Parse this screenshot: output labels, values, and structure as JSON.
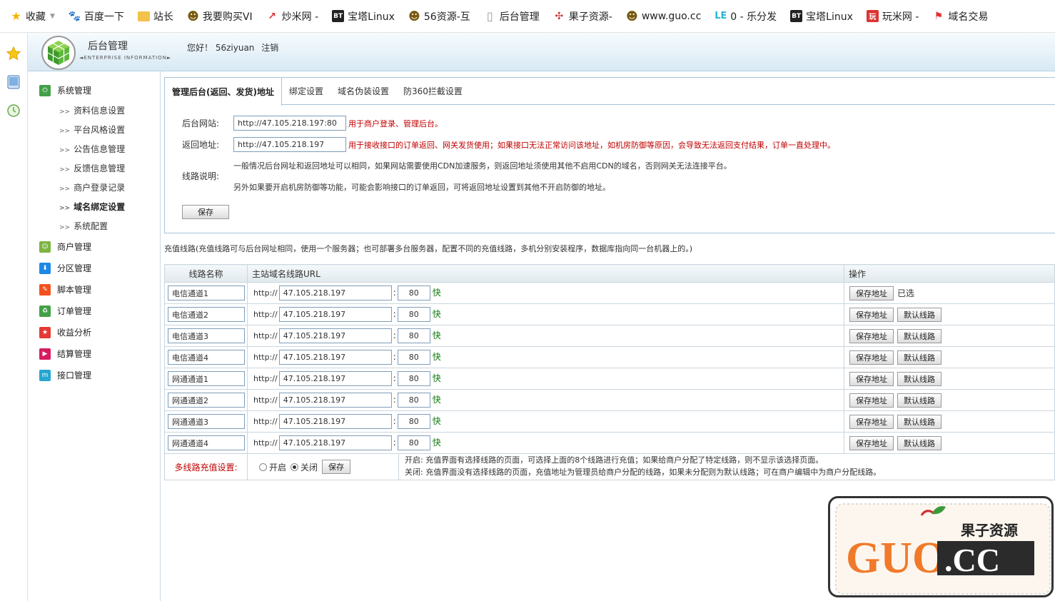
{
  "bookmarks": [
    {
      "label": "收藏",
      "icon": "star-icon"
    },
    {
      "label": "百度一下",
      "icon": "baidu-icon"
    },
    {
      "label": "站长",
      "icon": "folder-icon"
    },
    {
      "label": "我要购买VI",
      "icon": "face-icon"
    },
    {
      "label": "炒米网 -",
      "icon": "chart-icon"
    },
    {
      "label": "宝塔Linux",
      "icon": "bt-icon"
    },
    {
      "label": "56资源-互",
      "icon": "face-icon"
    },
    {
      "label": "后台管理",
      "icon": "page-icon"
    },
    {
      "label": "果子资源-",
      "icon": "dots-icon"
    },
    {
      "label": "www.guo.cc",
      "icon": "face-icon"
    },
    {
      "label": "0 - 乐分发",
      "icon": "le-icon"
    },
    {
      "label": "宝塔Linux",
      "icon": "bt-icon"
    },
    {
      "label": "玩米网 -",
      "icon": "wan-icon"
    },
    {
      "label": "域名交易",
      "icon": "domain-icon"
    }
  ],
  "header": {
    "title": "后台管理",
    "subtitle": "◄ENTERPRISE INFORMATION►",
    "greeting": "您好！",
    "username": "56ziyuan",
    "logout": "注销"
  },
  "menu": {
    "system": "系统管理",
    "system_items": [
      "资料信息设置",
      "平台风格设置",
      "公告信息管理",
      "反馈信息管理",
      "商户登录记录",
      "域名绑定设置",
      "系统配置"
    ],
    "groups": [
      {
        "label": "商户管理",
        "color": "#7cb342"
      },
      {
        "label": "分区管理",
        "color": "#1e88e5"
      },
      {
        "label": "脚本管理",
        "color": "#f4511e"
      },
      {
        "label": "订单管理",
        "color": "#43a047"
      },
      {
        "label": "收益分析",
        "color": "#e53935"
      },
      {
        "label": "结算管理",
        "color": "#d81b60"
      },
      {
        "label": "接口管理",
        "color": "#26a6d1"
      }
    ]
  },
  "tabs": [
    "管理后台(返回、发货)地址",
    "绑定设置",
    "域名伪装设置",
    "防360拦截设置"
  ],
  "form": {
    "admin_label": "后台网站:",
    "admin_value": "http://47.105.218.197:80",
    "admin_note": "用于商户登录、管理后台。",
    "return_label": "返回地址:",
    "return_value": "http://47.105.218.197",
    "return_note": "用于接收接口的订单返回、网关发货使用；如果接口无法正常访问该地址，如机房防御等原因，会导致无法返回支付结果，订单一直处理中。",
    "line_label": "线路说明:",
    "line_note1": "一般情况后台网址和返回地址可以相同，如果网站需要使用CDN加速服务，则返回地址须使用其他不启用CDN的域名，否则网关无法连接平台。",
    "line_note2": "另外如果要开启机房防御等功能，可能会影响接口的订单返回，可将返回地址设置到其他不开启防御的地址。",
    "save": "保存"
  },
  "intro": "充值线路(充值线路可与后台网址相同，使用一个服务器；也可部署多台服务器，配置不同的充值线路，多机分别安装程序，数据库指向同一台机器上的。)",
  "table": {
    "headers": [
      "线路名称",
      "主站域名线路URL",
      "操作"
    ],
    "rows": [
      {
        "name": "电信通道1",
        "host": "47.105.218.197",
        "port": "80",
        "default": false
      },
      {
        "name": "电信通道2",
        "host": "47.105.218.197",
        "port": "80",
        "default": true
      },
      {
        "name": "电信通道3",
        "host": "47.105.218.197",
        "port": "80",
        "default": true
      },
      {
        "name": "电信通道4",
        "host": "47.105.218.197",
        "port": "80",
        "default": true
      },
      {
        "name": "网通通道1",
        "host": "47.105.218.197",
        "port": "80",
        "default": true
      },
      {
        "name": "网通通道2",
        "host": "47.105.218.197",
        "port": "80",
        "default": true
      },
      {
        "name": "网通通道3",
        "host": "47.105.218.197",
        "port": "80",
        "default": true
      },
      {
        "name": "网通通道4",
        "host": "47.105.218.197",
        "port": "80",
        "default": true
      }
    ],
    "http": "http://",
    "colon": ":",
    "fast": "快",
    "save_addr": "保存地址",
    "default_line": "默认线路",
    "chosen": "已选"
  },
  "multi": {
    "label": "多线路充值设置:",
    "on": "开启",
    "off": "关闭",
    "save": "保存",
    "desc_on": "开启: 充值界面有选择线路的页面，可选择上面的8个线路进行充值；如果给商户分配了特定线路，则不显示该选择页面。",
    "desc_off": "关闭: 充值界面没有选择线路的页面，充值地址为管理员给商户分配的线路，如果未分配则为默认线路；可在商户编辑中为商户分配线路。"
  },
  "watermark": {
    "brand": "GUO",
    "tld": ".CC",
    "cn": "果子资源"
  }
}
